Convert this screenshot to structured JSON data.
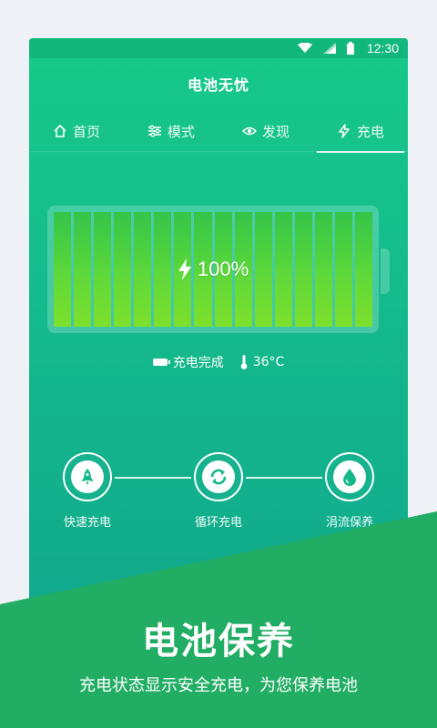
{
  "status_bar": {
    "time": "12:30"
  },
  "app": {
    "title": "电池无忧"
  },
  "tabs": [
    {
      "label": "首页",
      "icon": "home-icon"
    },
    {
      "label": "模式",
      "icon": "sliders-icon"
    },
    {
      "label": "发现",
      "icon": "eye-icon"
    },
    {
      "label": "充电",
      "icon": "bolt-icon",
      "active": true
    }
  ],
  "battery": {
    "level_text": "100%",
    "level": 1.0,
    "cells": 16,
    "status": "充电完成",
    "temperature": "36°C"
  },
  "modes": [
    {
      "label": "快速充电",
      "icon": "rocket-icon"
    },
    {
      "label": "循环充电",
      "icon": "cycle-icon"
    },
    {
      "label": "涓流保养",
      "icon": "drop-icon"
    }
  ],
  "promo": {
    "title": "电池保养",
    "subtitle": "充电状态显示安全充电，为您保养电池"
  },
  "colors": {
    "background": "#eef1f5",
    "app_green": "#17c98a",
    "app_teal": "#11a98d",
    "banner_green": "#21ad63",
    "cell_green": "#5ed83a"
  }
}
